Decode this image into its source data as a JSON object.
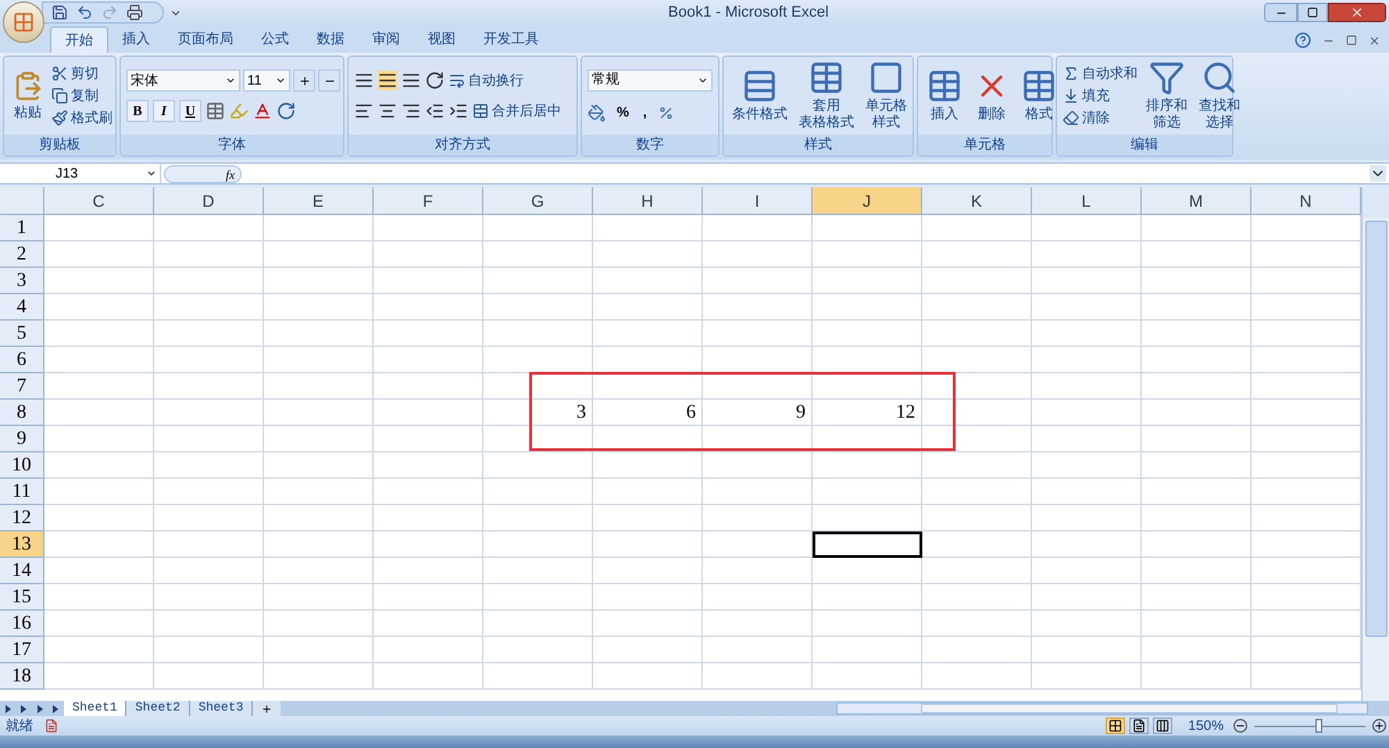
{
  "window": {
    "title": "Book1 - Microsoft Excel"
  },
  "tabs": [
    {
      "label": "开始",
      "selected": true
    },
    {
      "label": "插入",
      "selected": false
    },
    {
      "label": "页面布局",
      "selected": false
    },
    {
      "label": "公式",
      "selected": false
    },
    {
      "label": "数据",
      "selected": false
    },
    {
      "label": "审阅",
      "selected": false
    },
    {
      "label": "视图",
      "selected": false
    },
    {
      "label": "开发工具",
      "selected": false
    }
  ],
  "ribbon": {
    "clipboard": {
      "title": "剪贴板",
      "paste": "粘贴",
      "small": [
        "剪切",
        "复制",
        "格式刷"
      ]
    },
    "font": {
      "title": "字体",
      "font_name": "宋体",
      "font_size": "11",
      "format_buttons": [
        "B",
        "I",
        "U"
      ]
    },
    "alignment": {
      "title": "对齐方式",
      "wrap": "自动换行",
      "merge": "合并后居中"
    },
    "number": {
      "title": "数字",
      "format": "常规",
      "symbols": [
        "%",
        ","
      ]
    },
    "styles": {
      "title": "样式",
      "items": [
        [
          "条件格式"
        ],
        [
          "套用",
          "表格格式"
        ],
        [
          "单元格",
          "样式"
        ]
      ]
    },
    "cells": {
      "title": "单元格",
      "items": [
        [
          "插入"
        ],
        [
          "删除"
        ],
        [
          "格式"
        ]
      ]
    },
    "editing": {
      "title": "编辑",
      "small": [
        "自动求和",
        "填充",
        "清除"
      ],
      "large": [
        [
          "排序和",
          "筛选"
        ],
        [
          "查找和",
          "选择"
        ]
      ]
    }
  },
  "formula_bar": {
    "name_box": "J13",
    "fx": "fx"
  },
  "grid": {
    "columns": [
      {
        "label": "C",
        "selected": false
      },
      {
        "label": "D",
        "selected": false
      },
      {
        "label": "E",
        "selected": false
      },
      {
        "label": "F",
        "selected": false
      },
      {
        "label": "G",
        "selected": false
      },
      {
        "label": "H",
        "selected": false
      },
      {
        "label": "I",
        "selected": false
      },
      {
        "label": "J",
        "selected": true
      },
      {
        "label": "K",
        "selected": false
      },
      {
        "label": "L",
        "selected": false
      },
      {
        "label": "M",
        "selected": false
      },
      {
        "label": "N",
        "selected": false
      }
    ],
    "rows": [
      {
        "label": "1",
        "selected": false
      },
      {
        "label": "2",
        "selected": false
      },
      {
        "label": "3",
        "selected": false
      },
      {
        "label": "4",
        "selected": false
      },
      {
        "label": "5",
        "selected": false
      },
      {
        "label": "6",
        "selected": false
      },
      {
        "label": "7",
        "selected": false
      },
      {
        "label": "8",
        "selected": false,
        "cells": [
          null,
          null,
          null,
          null,
          "3",
          "6",
          "9",
          "12",
          null,
          null,
          null,
          null
        ]
      },
      {
        "label": "9",
        "selected": false
      },
      {
        "label": "10",
        "selected": false
      },
      {
        "label": "11",
        "selected": false
      },
      {
        "label": "12",
        "selected": false
      },
      {
        "label": "13",
        "selected": true
      },
      {
        "label": "14",
        "selected": false
      },
      {
        "label": "15",
        "selected": false
      },
      {
        "label": "16",
        "selected": false
      },
      {
        "label": "17",
        "selected": false
      },
      {
        "label": "18",
        "selected": false
      }
    ]
  },
  "sheet_tabs": [
    {
      "label": "Sheet1",
      "selected": true
    },
    {
      "label": "Sheet2",
      "selected": false
    },
    {
      "label": "Sheet3",
      "selected": false
    }
  ],
  "status_bar": {
    "status": "就绪",
    "zoom": "150%",
    "views": [
      {
        "kind": "normal",
        "selected": true
      },
      {
        "kind": "layout",
        "selected": false
      },
      {
        "kind": "pagebreak",
        "selected": false
      }
    ],
    "zoom_slider": {
      "level": 0.58
    }
  }
}
